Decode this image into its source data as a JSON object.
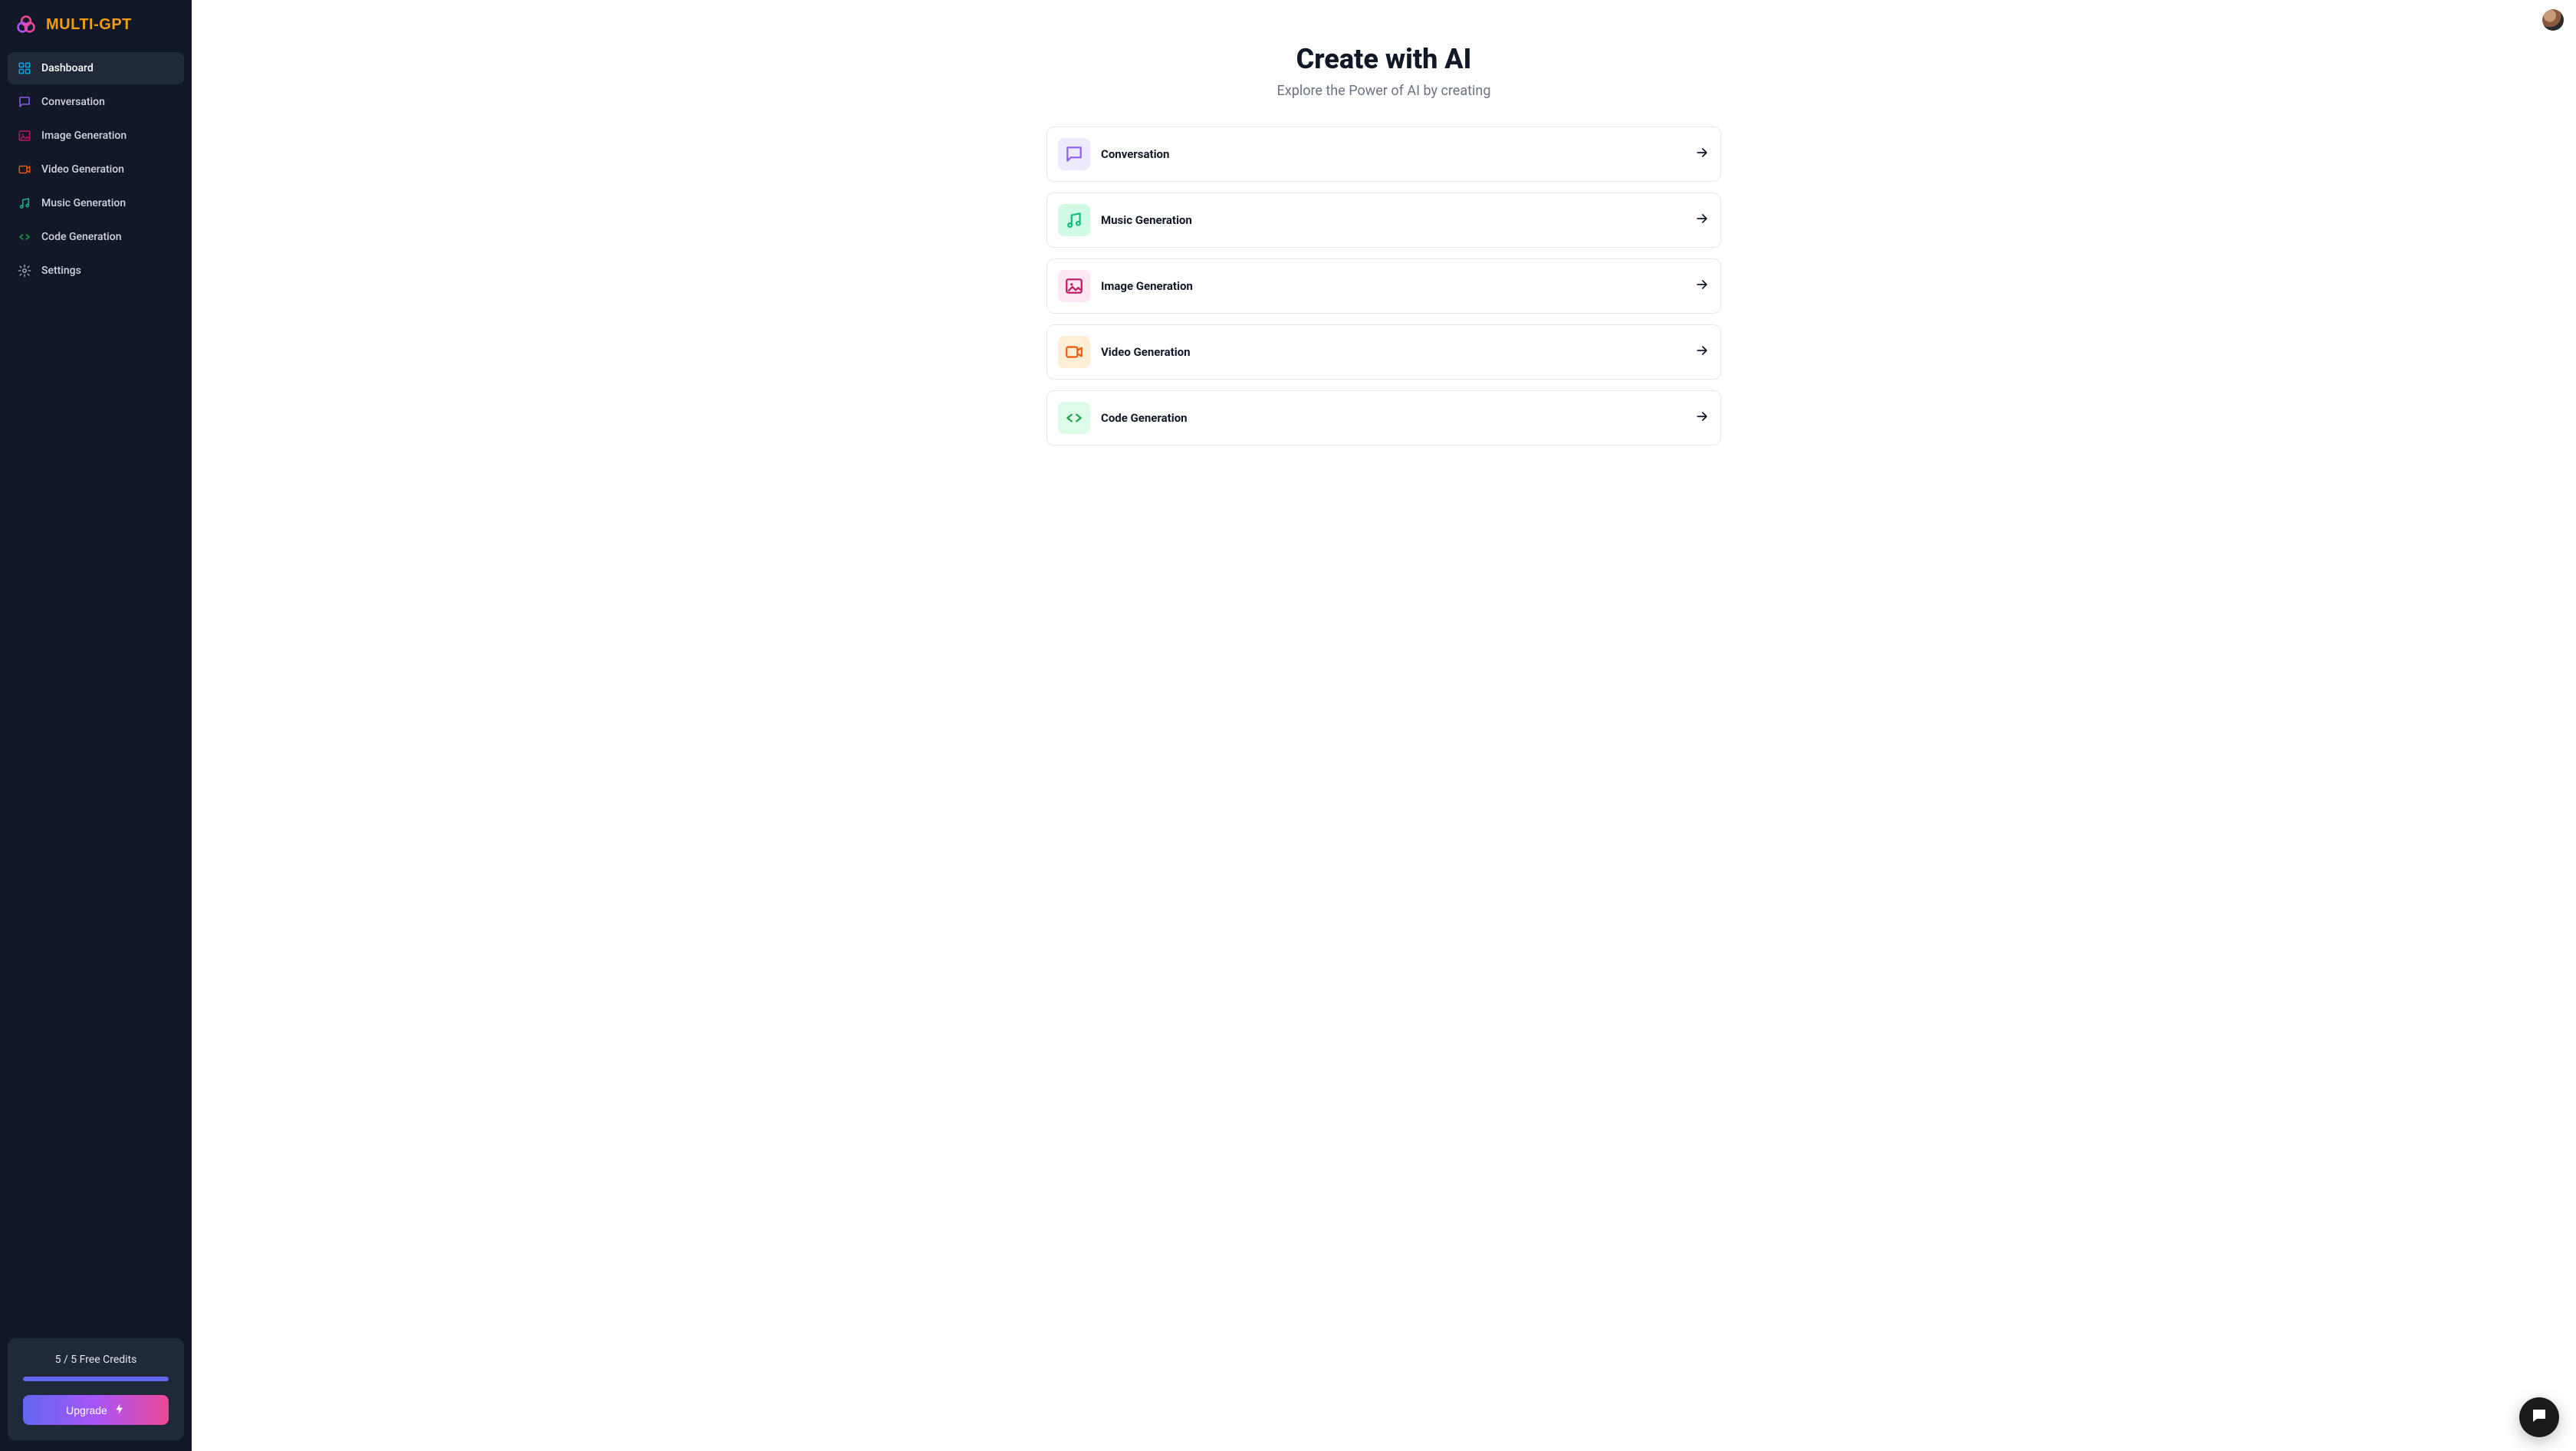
{
  "brand": {
    "name": "MULTI-GPT"
  },
  "sidebar": {
    "items": [
      {
        "label": "Dashboard"
      },
      {
        "label": "Conversation"
      },
      {
        "label": "Image Generation"
      },
      {
        "label": "Video Generation"
      },
      {
        "label": "Music Generation"
      },
      {
        "label": "Code Generation"
      },
      {
        "label": "Settings"
      }
    ]
  },
  "credits": {
    "used": 5,
    "total": 5,
    "label_suffix": "Free Credits",
    "upgrade_label": "Upgrade"
  },
  "main": {
    "title": "Create with AI",
    "subtitle": "Explore the Power of AI by creating"
  },
  "cards": [
    {
      "title": "Conversation"
    },
    {
      "title": "Music Generation"
    },
    {
      "title": "Image Generation"
    },
    {
      "title": "Video Generation"
    },
    {
      "title": "Code Generation"
    }
  ]
}
